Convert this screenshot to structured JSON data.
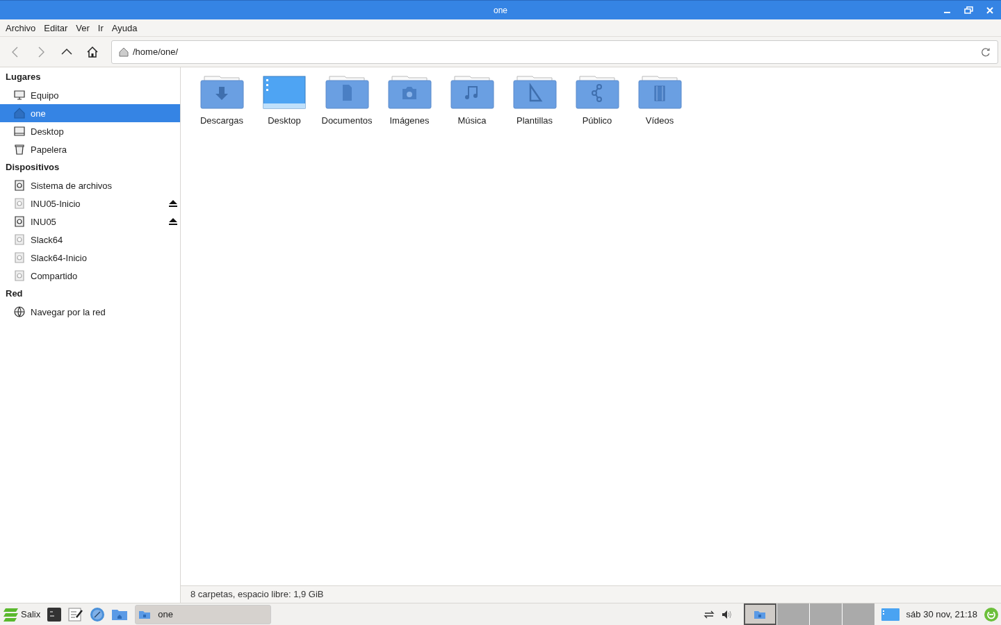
{
  "window": {
    "title": "one"
  },
  "menu": [
    "Archivo",
    "Editar",
    "Ver",
    "Ir",
    "Ayuda"
  ],
  "location": {
    "value": "/home/one/"
  },
  "sidebar": {
    "sections": [
      {
        "title": "Lugares",
        "items": [
          {
            "label": "Equipo",
            "kind": "computer",
            "selected": false,
            "mounted": true,
            "eject": false
          },
          {
            "label": "one",
            "kind": "home",
            "selected": true,
            "mounted": true,
            "eject": false
          },
          {
            "label": "Desktop",
            "kind": "desktop",
            "selected": false,
            "mounted": true,
            "eject": false
          },
          {
            "label": "Papelera",
            "kind": "trash",
            "selected": false,
            "mounted": true,
            "eject": false
          }
        ]
      },
      {
        "title": "Dispositivos",
        "items": [
          {
            "label": "Sistema de archivos",
            "kind": "drive",
            "selected": false,
            "mounted": true,
            "eject": false
          },
          {
            "label": "INU05-Inicio",
            "kind": "drive",
            "selected": false,
            "mounted": false,
            "eject": true
          },
          {
            "label": "INU05",
            "kind": "drive",
            "selected": false,
            "mounted": true,
            "eject": true
          },
          {
            "label": "Slack64",
            "kind": "drive",
            "selected": false,
            "mounted": false,
            "eject": false
          },
          {
            "label": "Slack64-Inicio",
            "kind": "drive",
            "selected": false,
            "mounted": false,
            "eject": false
          },
          {
            "label": "Compartido",
            "kind": "drive",
            "selected": false,
            "mounted": false,
            "eject": false
          }
        ]
      },
      {
        "title": "Red",
        "items": [
          {
            "label": "Navegar por la red",
            "kind": "network",
            "selected": false,
            "mounted": true,
            "eject": false
          }
        ]
      }
    ]
  },
  "folders": [
    {
      "label": "Descargas",
      "kind": "download"
    },
    {
      "label": "Desktop",
      "kind": "desktop"
    },
    {
      "label": "Documentos",
      "kind": "document"
    },
    {
      "label": "Imágenes",
      "kind": "camera"
    },
    {
      "label": "Música",
      "kind": "music"
    },
    {
      "label": "Plantillas",
      "kind": "template"
    },
    {
      "label": "Público",
      "kind": "share"
    },
    {
      "label": "Vídeos",
      "kind": "video"
    }
  ],
  "status_bar": "8 carpetas, espacio libre: 1,9 GiB",
  "taskbar": {
    "start_label": "Salix",
    "windows": [
      {
        "label": "one",
        "selected": true
      }
    ],
    "workspaces": [
      {
        "selected": true
      },
      {
        "selected": false
      },
      {
        "selected": false
      },
      {
        "selected": false
      }
    ],
    "clock": "sáb 30 nov, 21:18"
  }
}
